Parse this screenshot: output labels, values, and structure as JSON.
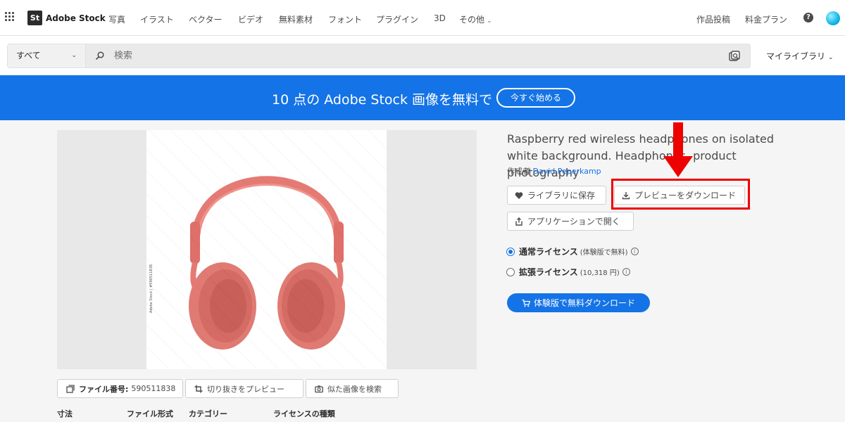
{
  "nav": {
    "logo_mark": "St",
    "logo_text": "Adobe Stock",
    "links": [
      "写真",
      "イラスト",
      "ベクター",
      "ビデオ",
      "無料素材",
      "フォント",
      "プラグイン",
      "3D",
      "その他"
    ],
    "right_links": [
      "作品投稿",
      "料金プラン"
    ],
    "help": "?"
  },
  "search": {
    "scope": "すべて",
    "placeholder": "検索",
    "my_library": "マイライブラリ"
  },
  "promo": {
    "text": "10 点の Adobe Stock 画像を無料で",
    "button": "今すぐ始める",
    "color": "#1473e6"
  },
  "asset": {
    "vertical_credit": "Adobe Stock | #590511838",
    "title": "Raspberry red wireless headphones on isolated white background. Headphones, product photography",
    "author_label": "作成者",
    "author_name": "David Peperkamp"
  },
  "actions": {
    "save": "ライブラリに保存",
    "download_preview": "プレビューをダウンロード",
    "open_in_app": "アプリケーションで開く"
  },
  "licenses": [
    {
      "name": "通常ライセンス",
      "note": "(体験版で無料)",
      "selected": true
    },
    {
      "name": "拡張ライセンス",
      "note": "(10,318 円)",
      "selected": false
    }
  ],
  "primary": {
    "label": "体験版で無料ダウンロード"
  },
  "meta": {
    "file_id_label": "ファイル番号:",
    "file_id": "590511838",
    "crop_preview": "切り抜きをプレビュー",
    "find_similar": "似た画像を検索"
  },
  "specs": [
    "寸法",
    "ファイル形式",
    "カテゴリー",
    "ライセンスの種類"
  ],
  "annotation": {
    "highlight_color": "#ee0000"
  }
}
